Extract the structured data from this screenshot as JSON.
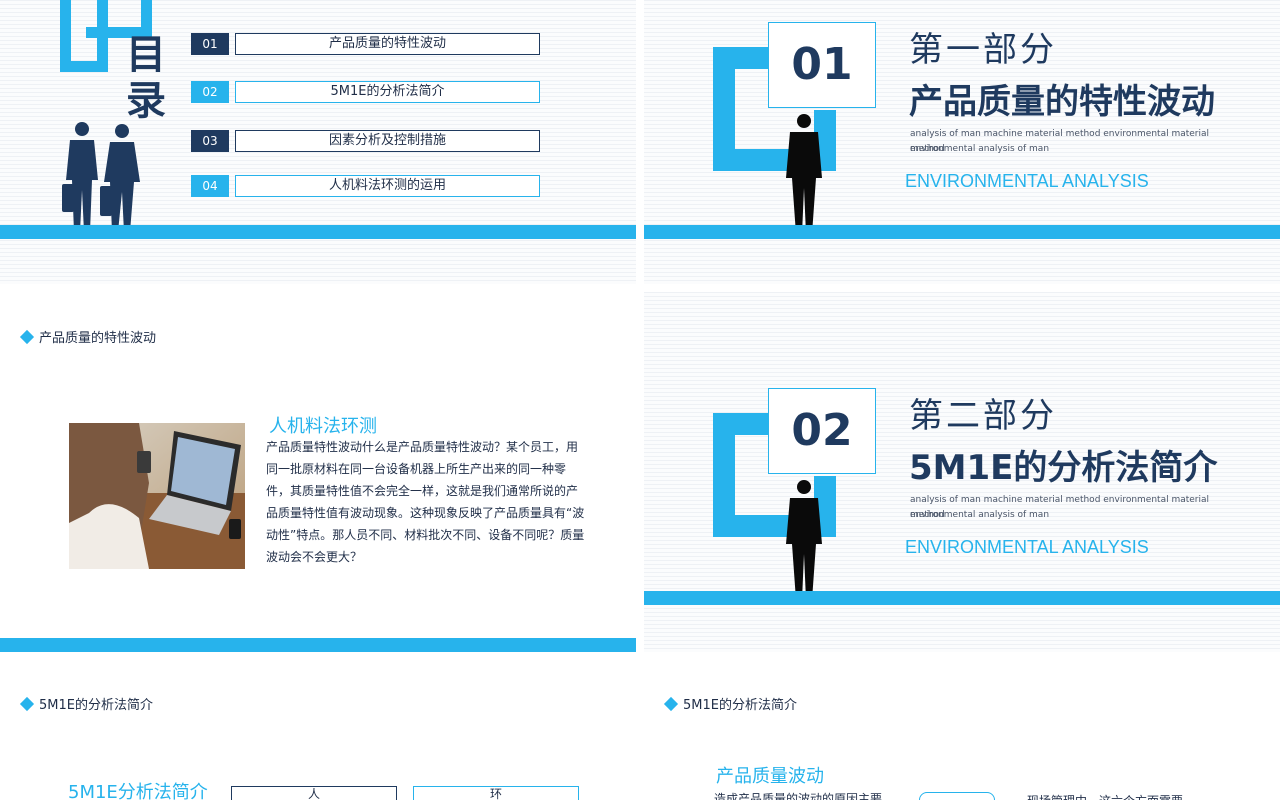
{
  "toc": {
    "title": "目录",
    "items": [
      {
        "num": "01",
        "label": "产品质量的特性波动"
      },
      {
        "num": "02",
        "label": "5M1E的分析法简介"
      },
      {
        "num": "03",
        "label": "因素分析及控制措施"
      },
      {
        "num": "04",
        "label": "人机料法环测的运用"
      }
    ]
  },
  "sections": [
    {
      "number": "01",
      "part": "第一部分",
      "title": "产品质量的特性波动",
      "small_text_1": "analysis of man machine material method environmental material method",
      "small_text_2": "environmental analysis of man",
      "english": "ENVIRONMENTAL ANALYSIS"
    },
    {
      "number": "02",
      "part": "第二部分",
      "title": "5M1E的分析法简介",
      "small_text_1": "analysis of man machine material method environmental material method",
      "small_text_2": "environmental analysis of man",
      "english": "ENVIRONMENTAL ANALYSIS"
    }
  ],
  "content": {
    "breadcrumb": "产品质量的特性波动",
    "heading": "人机料法环测",
    "paragraph": "产品质量特性波动什么是产品质量特性波动？某个员工，用同一批原材料在同一台设备机器上所生产出来的同一种零件，其质量特性值不会完全一样，这就是我们通常所说的产品质量特性值有波动现象。这种现象反映了产品质量具有“波动性”特点。那人员不同、材料批次不同、设备不同呢？质量波动会不会更大？"
  },
  "bottom_left": {
    "breadcrumb": "5M1E的分析法简介",
    "heading": "5M1E分析法简介",
    "box1": "人",
    "box2": "环"
  },
  "bottom_right": {
    "breadcrumb": "5M1E的分析法简介",
    "heading": "产品质量波动",
    "text_left": "造成产品质量的波动的原因主要",
    "text_right": "现场管理中，这六个方面需要"
  },
  "colors": {
    "accent": "#27b3ec",
    "navy": "#1f3a5f"
  }
}
